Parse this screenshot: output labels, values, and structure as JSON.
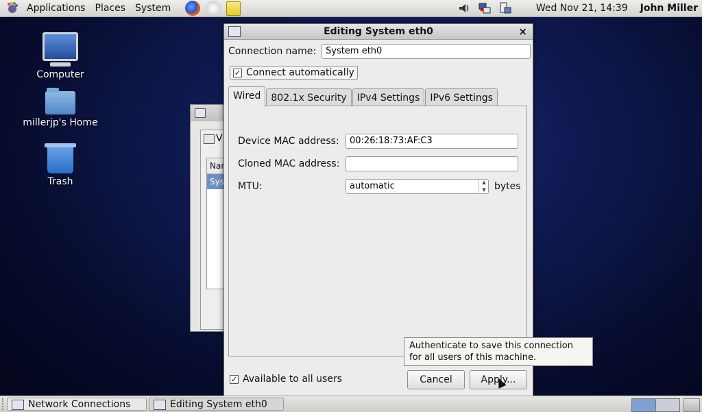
{
  "top_panel": {
    "menus": [
      "Applications",
      "Places",
      "System"
    ],
    "clock": "Wed Nov 21, 14:39",
    "user": "John Miller"
  },
  "desktop": {
    "icons": [
      {
        "label": "Computer"
      },
      {
        "label": "millerjp's Home"
      },
      {
        "label": "Trash"
      }
    ]
  },
  "background_window": {
    "title_partial": "V",
    "list_header": "Nar",
    "list_selected": "Sys"
  },
  "dialog": {
    "title": "Editing System eth0",
    "close_glyph": "×",
    "connection_name_label": "Connection name:",
    "connection_name_value": "System eth0",
    "connect_automatically_label": "Connect automatically",
    "connect_automatically_checked": true,
    "tabs": [
      "Wired",
      "802.1x Security",
      "IPv4 Settings",
      "IPv6 Settings"
    ],
    "active_tab": "Wired",
    "wired": {
      "device_mac_label": "Device MAC address:",
      "device_mac_value": "00:26:18:73:AF:C3",
      "cloned_mac_label": "Cloned MAC address:",
      "cloned_mac_value": "",
      "mtu_label": "MTU:",
      "mtu_value": "automatic",
      "mtu_unit": "bytes"
    },
    "available_all_users_label": "Available to all users",
    "available_all_users_checked": true,
    "cancel_label": "Cancel",
    "apply_label": "Apply...",
    "tooltip": "Authenticate to save this connection for all users of this machine."
  },
  "taskbar": {
    "tasks": [
      "Network Connections",
      "Editing System eth0"
    ]
  }
}
